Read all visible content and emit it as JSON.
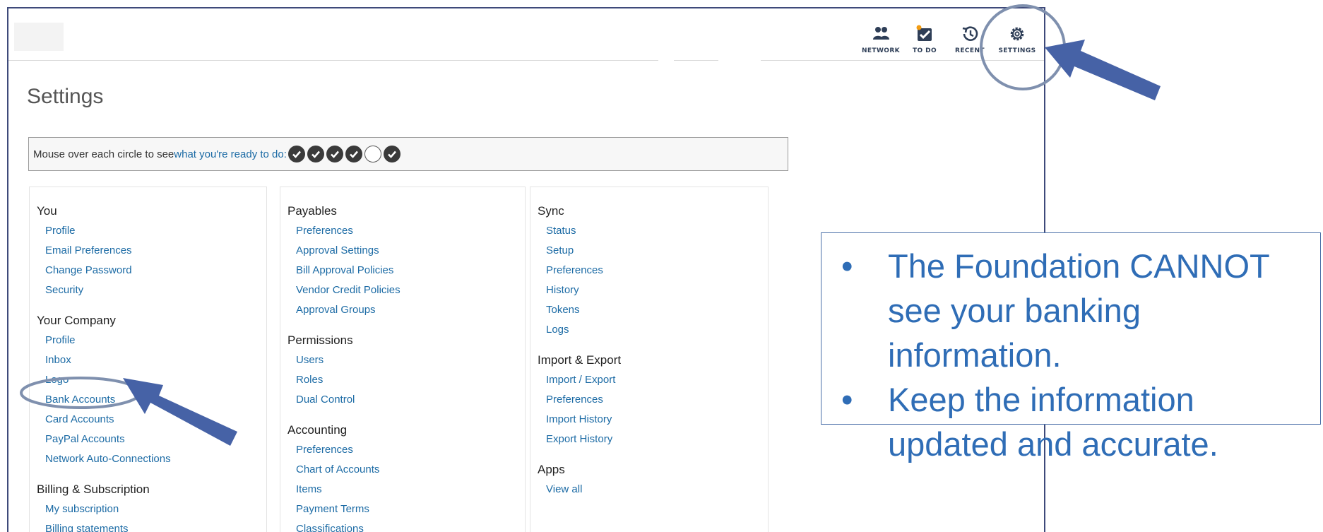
{
  "nav": {
    "network": "NETWORK",
    "todo": "TO DO",
    "recent": "RECENT",
    "settings": "SETTINGS"
  },
  "page": {
    "title": "Settings"
  },
  "readiness": {
    "prefix": "Mouse over each circle to see ",
    "link": "what you're ready to do:",
    "states": [
      "done",
      "done",
      "done",
      "done",
      "pending",
      "done"
    ]
  },
  "columns": [
    {
      "groups": [
        {
          "title": "You",
          "links": [
            "Profile",
            "Email Preferences",
            "Change Password",
            "Security"
          ]
        },
        {
          "title": "Your Company",
          "links": [
            "Profile",
            "Inbox",
            "Logo",
            "Bank Accounts",
            "Card Accounts",
            "PayPal Accounts",
            "Network Auto-Connections"
          ]
        },
        {
          "title": "Billing & Subscription",
          "links": [
            "My subscription",
            "Billing statements"
          ]
        }
      ]
    },
    {
      "groups": [
        {
          "title": "Payables",
          "links": [
            "Preferences",
            "Approval Settings",
            "Bill Approval Policies",
            "Vendor Credit Policies",
            "Approval Groups"
          ]
        },
        {
          "title": "Permissions",
          "links": [
            "Users",
            "Roles",
            "Dual Control"
          ]
        },
        {
          "title": "Accounting",
          "links": [
            "Preferences",
            "Chart of Accounts",
            "Items",
            "Payment Terms",
            "Classifications"
          ]
        }
      ]
    },
    {
      "groups": [
        {
          "title": "Sync",
          "links": [
            "Status",
            "Setup",
            "Preferences",
            "History",
            "Tokens",
            "Logs"
          ]
        },
        {
          "title": "Import & Export",
          "links": [
            "Import / Export",
            "Preferences",
            "Import History",
            "Export History"
          ]
        },
        {
          "title": "Apps",
          "links": [
            "View all"
          ]
        }
      ]
    }
  ],
  "callout": {
    "items": [
      {
        "bullet": "•",
        "text": "The Foundation CANNOT see your banking information."
      },
      {
        "bullet": "•",
        "text": "Keep the information updated and accurate."
      }
    ]
  },
  "colors": {
    "link": "#1c6ba5",
    "nav_text": "#2e3e57",
    "callout_text": "#2f6db6",
    "arrow": "#4662a6",
    "highlight_ring": "#7f90ae",
    "todo_badge": "#f39c12"
  }
}
